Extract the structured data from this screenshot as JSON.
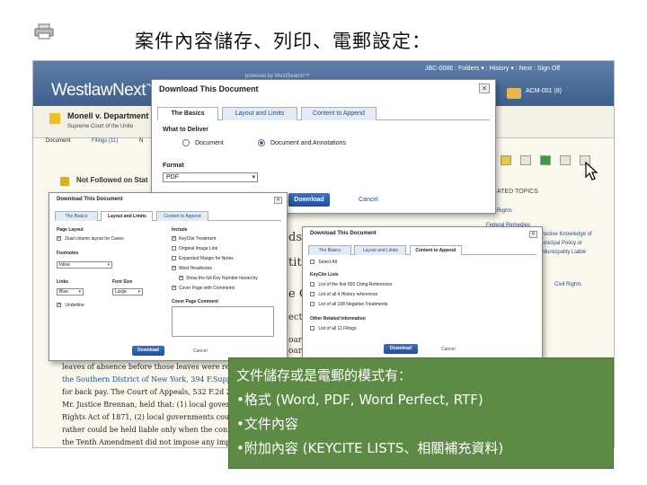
{
  "slide": {
    "title": "案件內容儲存、列印、電郵設定："
  },
  "westlaw": {
    "logo": "WestlawNext",
    "logo_tm": "™",
    "powered_by": "powered by WestSearch™",
    "top_nav": "JBC-0086 : Folders ▾ : History ▾ : Next : Sign Off",
    "folder_label": "ACM-001 (8)",
    "case_title": "Monell v. Department",
    "court": "Supreme Court of the Unite",
    "tabs": [
      "Document",
      "Filings (11)",
      "N"
    ],
    "not_followed": "Not Followed on Stat",
    "related_title": "ATED TOPICS",
    "related_items": [
      "Rights",
      "Federal Remedies",
      "ructive Knowledge of",
      "unicipal Policy or",
      "Municipality Liable",
      "Civil Rights"
    ],
    "bg_fragments": [
      "ds",
      "titi",
      "e C",
      "ect",
      "oar",
      "oar"
    ],
    "body_lines": [
      "leaves of absence before those leaves were requi",
      "the Southern District of New York, 394 F.Supp.",
      "for back pay. The Court of Appeals, 532 F.2d 25",
      "Mr. Justice Brennan, held that: (1) local governm",
      "Rights Act of 1871, (2) local governments could",
      "rather could be held liable only when the constit",
      "the Tenth Amendment did not impose any impedi"
    ]
  },
  "dialog_main": {
    "title": "Download This Document",
    "close": "✕",
    "tabs": [
      "The Basics",
      "Layout and Limits",
      "Content to Append"
    ],
    "what_to_deliver": "What to Deliver",
    "options": [
      "Document",
      "Document and Annotations"
    ],
    "format_label": "Format",
    "format_value": "PDF",
    "download_fragment": "Download",
    "cancel": "Cancel"
  },
  "dialog_layout": {
    "title": "Download This Document",
    "close": "✕",
    "tabs": [
      "The Basics",
      "Layout and Limits",
      "Content to Append"
    ],
    "page_layout": "Page Layout",
    "dual_column": "Dual column layout for Cases",
    "footnotes": "Footnotes",
    "footnotes_value": "Inline",
    "links": "Links",
    "links_value": "Blue",
    "font_size": "Font Size",
    "font_size_value": "Large",
    "underline": "Underline",
    "include": "Include",
    "include_items": [
      "KeyCite Treatment",
      "Original Image Link",
      "Expanded Margin for Notes",
      "West Headnotes",
      "Show the full Key Number hierarchy",
      "Cover Page with Comments"
    ],
    "include_checked": [
      true,
      false,
      false,
      true,
      true,
      true
    ],
    "cover_comment": "Cover Page Comment",
    "download": "Download",
    "cancel": "Cancel"
  },
  "dialog_append": {
    "title": "Download This Document",
    "close": "✕",
    "tabs": [
      "The Basics",
      "Layout and Limits",
      "Content to Append"
    ],
    "select_all": "Select All",
    "keycite_lists": "KeyCite Lists",
    "keycite_items": [
      "List of the first 500 Citing References",
      "List of all 4 History references",
      "List of all 198 Negative Treatments"
    ],
    "other_info": "Other Related Information",
    "other_items": [
      "List of all 11 Filings"
    ],
    "download": "Download",
    "cancel": "Cancel"
  },
  "callout": {
    "lines": [
      "文件儲存或是電郵的模式有：",
      "•格式 (Word, PDF, Word Perfect, RTF)",
      "•文件內容",
      "•附加內容 (KEYCITE LISTS、相關補充資料)"
    ]
  },
  "colors": {
    "westlaw_blue": "#4a6a96",
    "callout_green": "#5d8a45",
    "link_blue": "#1b4d9a",
    "button_blue": "#2a5fb0"
  },
  "icons": [
    "printer-icon",
    "folder-icon",
    "flag-icon",
    "close-icon",
    "chevron-down-icon",
    "cursor-icon"
  ]
}
